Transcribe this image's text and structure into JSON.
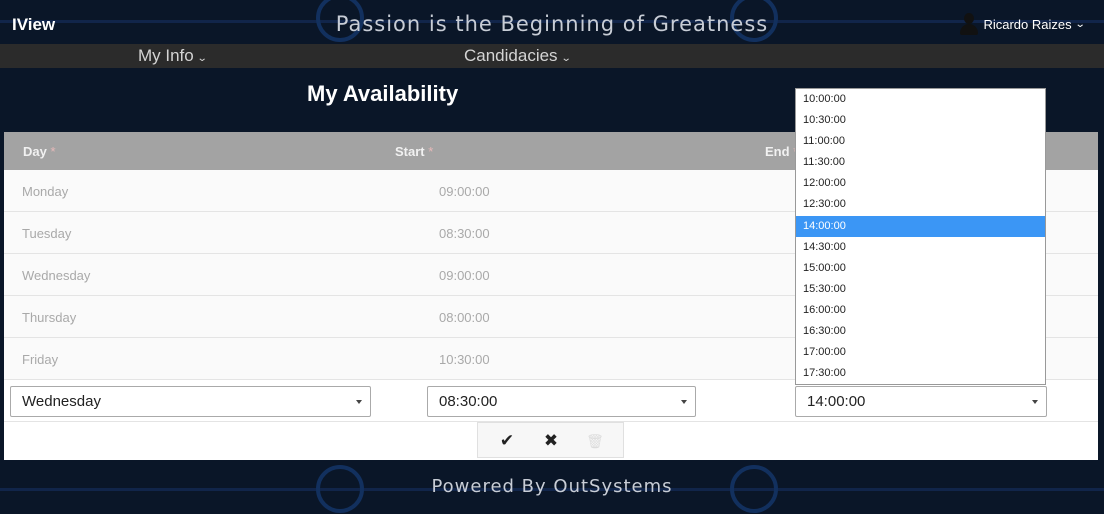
{
  "app": {
    "brand": "IView",
    "slogan": "Passion is the Beginning of Greatness",
    "footer": "Powered By OutSystems"
  },
  "user": {
    "name": "Ricardo Raizes",
    "icon": "user-icon"
  },
  "menu": [
    {
      "label": "My Info",
      "icon": "chevron-down-icon"
    },
    {
      "label": "Candidacies",
      "icon": "chevron-down-icon"
    }
  ],
  "page": {
    "title": "My Availability"
  },
  "table": {
    "headers": {
      "day": "Day",
      "start": "Start",
      "end": "End",
      "required_mark": "*"
    },
    "rows": [
      {
        "day": "Monday",
        "start": "09:00:00"
      },
      {
        "day": "Tuesday",
        "start": "08:30:00"
      },
      {
        "day": "Wednesday",
        "start": "09:00:00"
      },
      {
        "day": "Thursday",
        "start": "08:00:00"
      },
      {
        "day": "Friday",
        "start": "10:30:00"
      }
    ],
    "edit": {
      "day": "Wednesday",
      "start": "08:30:00",
      "end": "14:00:00"
    },
    "actions": {
      "confirm": "✔",
      "cancel": "✖",
      "delete": "🗑"
    }
  },
  "end_dropdown": {
    "options": [
      "10:00:00",
      "10:30:00",
      "11:00:00",
      "11:30:00",
      "12:00:00",
      "12:30:00",
      "14:00:00",
      "14:30:00",
      "15:00:00",
      "15:30:00",
      "16:00:00",
      "16:30:00",
      "17:00:00",
      "17:30:00"
    ],
    "selected_index": 6
  },
  "colors": {
    "background": "#0a1628",
    "menubar": "#2b2b2b",
    "table_header": "#a3a3a3",
    "highlight": "#3b96f5"
  }
}
